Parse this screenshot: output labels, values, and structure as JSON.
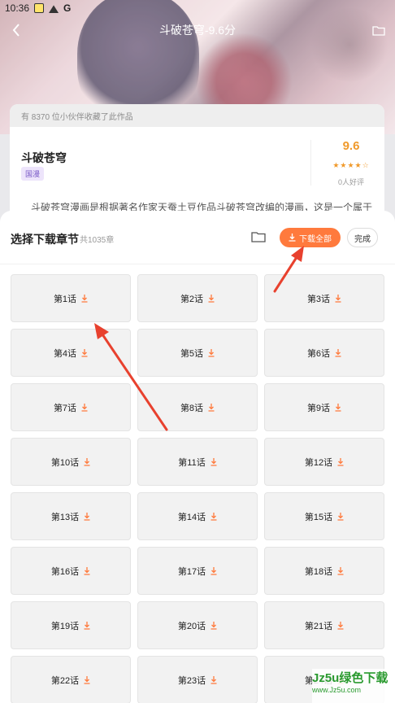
{
  "status_bar": {
    "time": "10:36",
    "g_icon": "G"
  },
  "top_bar": {
    "title": "斗破苍穹-9.6分",
    "back_icon": "back-chevron-icon",
    "folder_icon": "folder-icon"
  },
  "info": {
    "collected_text": "有 8370 位小伙伴收藏了此作品",
    "title": "斗破苍穹",
    "tag": "国漫",
    "score": "9.6",
    "stars": "★★★★☆",
    "praise": "0人好评",
    "description": "斗破苍穹漫画是根据著名作家天蚕土豆作品斗破苍穹改编的漫画，这是一个属于"
  },
  "sheet": {
    "title": "选择下载章节",
    "count": "共1035章",
    "download_all": "下载全部",
    "done": "完成",
    "accent": "#ff7a3d"
  },
  "chapters": [
    "第1话",
    "第2话",
    "第3话",
    "第4话",
    "第5话",
    "第6话",
    "第7话",
    "第8话",
    "第9话",
    "第10话",
    "第11话",
    "第12话",
    "第13话",
    "第14话",
    "第15话",
    "第16话",
    "第17话",
    "第18话",
    "第19话",
    "第20话",
    "第21话",
    "第22话",
    "第23话",
    "第24话"
  ],
  "watermark": {
    "main": "Jz5u绿色下载",
    "sub": "www.Jz5u.com"
  }
}
